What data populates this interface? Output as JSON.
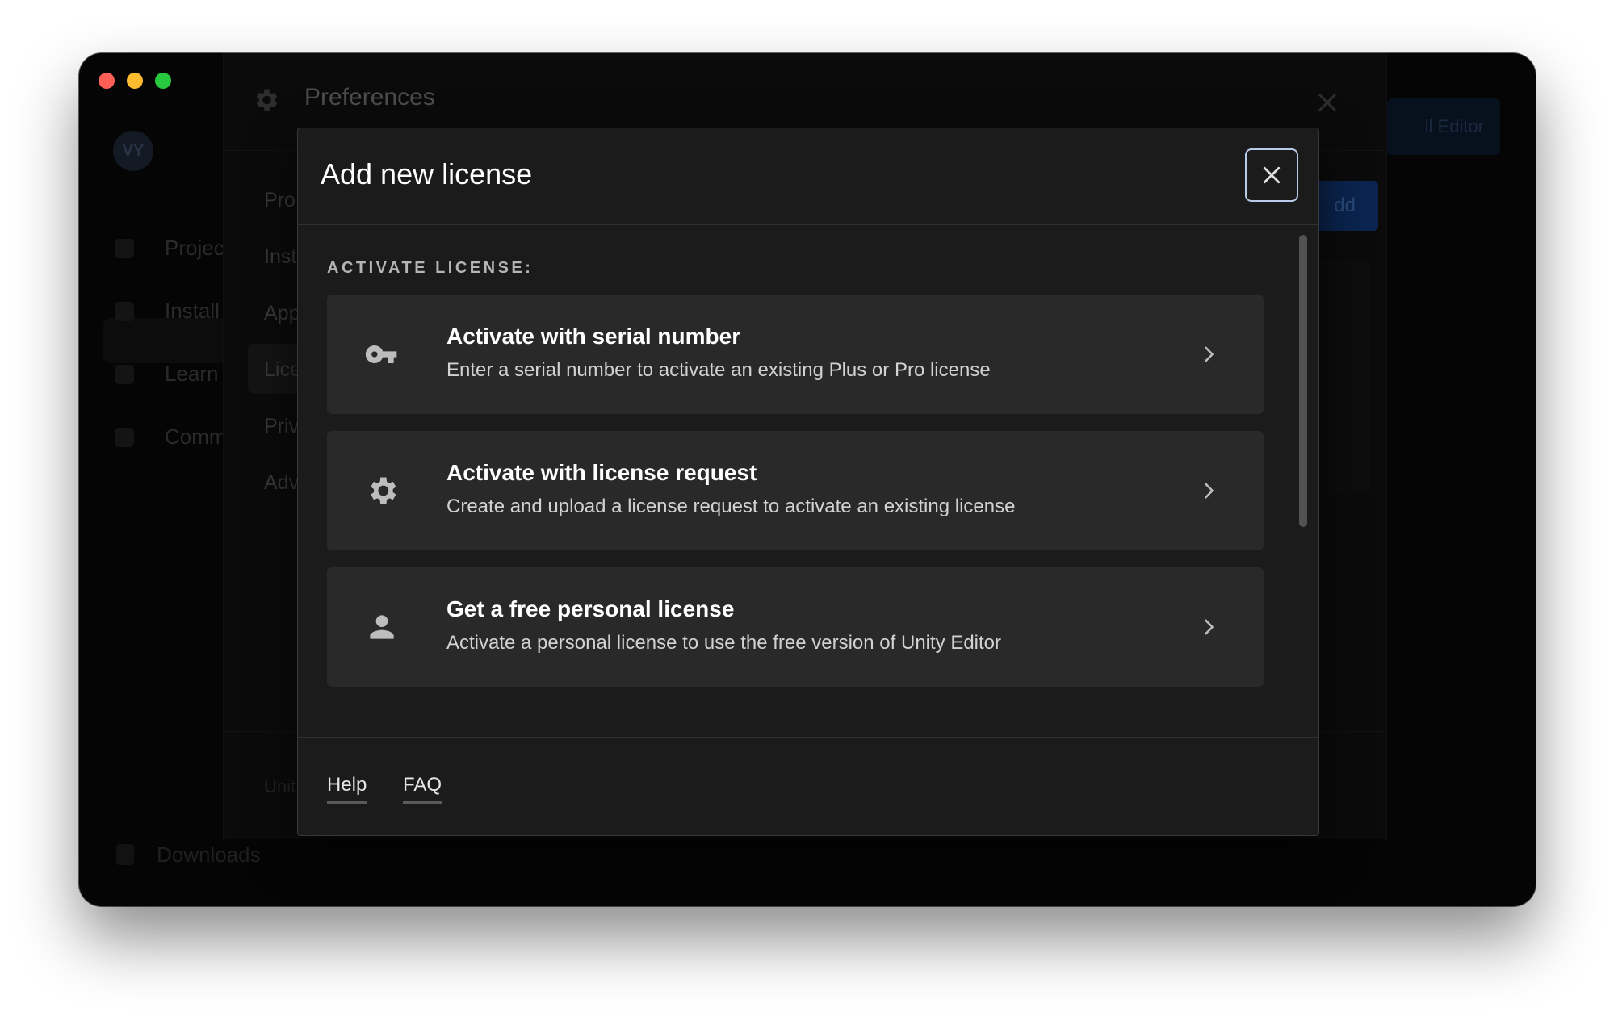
{
  "window": {
    "traffic_lights": [
      "close",
      "minimize",
      "zoom"
    ]
  },
  "background_app": {
    "avatar_initials": "VY",
    "sidebar_items": [
      "Projec",
      "Install",
      "Learn",
      "Comm"
    ],
    "downloads_label": "Downloads",
    "editor_button_label": "ll Editor",
    "preferences": {
      "title": "Preferences",
      "nav_items": [
        "Pro",
        "Inst",
        "App",
        "Lice",
        "Priv",
        "Adv"
      ],
      "footer_text": "Unit",
      "add_button_label": "dd"
    }
  },
  "modal": {
    "title": "Add new license",
    "close_icon": "close-icon",
    "section_label": "ACTIVATE LICENSE:",
    "options": [
      {
        "icon": "key-icon",
        "title": "Activate with serial number",
        "description": "Enter a serial number to activate an existing Plus or Pro license"
      },
      {
        "icon": "gear-icon",
        "title": "Activate with license request",
        "description": "Create and upload a license request to activate an existing license"
      },
      {
        "icon": "person-icon",
        "title": "Get a free personal license",
        "description": "Activate a personal license to use the free version of Unity Editor"
      }
    ],
    "footer_links": [
      "Help",
      "FAQ"
    ]
  },
  "colors": {
    "modal_bg": "#1b1b1b",
    "option_bg": "#292929",
    "focus_ring": "#b8cbe8",
    "traffic_red": "#ff5f57",
    "traffic_yellow": "#febc2e",
    "traffic_green": "#28c840"
  }
}
